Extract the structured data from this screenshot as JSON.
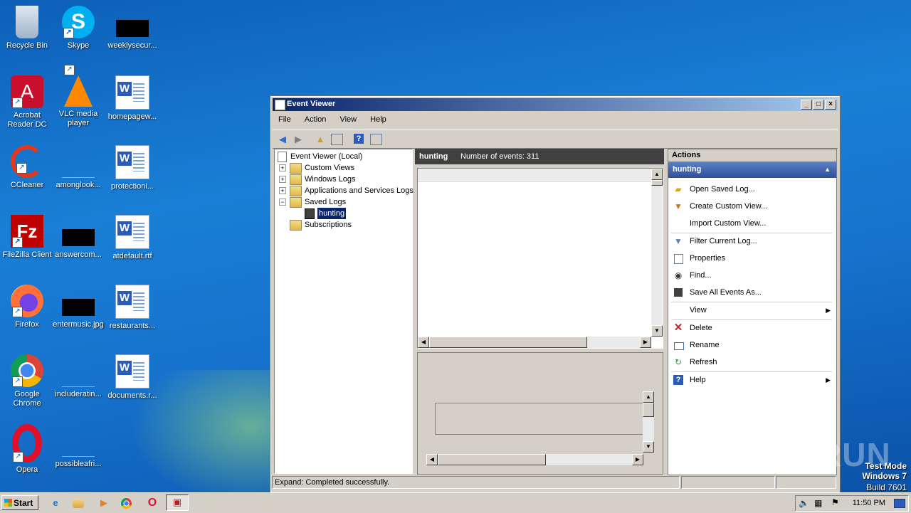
{
  "desktop": {
    "icons": [
      {
        "label": "Recycle Bin"
      },
      {
        "label": "Skype"
      },
      {
        "label": "weeklysecur..."
      },
      {
        "label": "Acrobat Reader DC"
      },
      {
        "label": "VLC media player"
      },
      {
        "label": "homepagew..."
      },
      {
        "label": "CCleaner"
      },
      {
        "label": "amonglook..."
      },
      {
        "label": "protectioni..."
      },
      {
        "label": "FileZilla Client"
      },
      {
        "label": "answercom..."
      },
      {
        "label": "atdefault.rtf"
      },
      {
        "label": "Firefox"
      },
      {
        "label": "entermusic.jpg"
      },
      {
        "label": "restaurants..."
      },
      {
        "label": "Google Chrome"
      },
      {
        "label": "includeratin..."
      },
      {
        "label": "documents.r..."
      },
      {
        "label": "Opera"
      },
      {
        "label": "possibleafri..."
      }
    ],
    "watermark": {
      "brand": "ANY RUN",
      "line1": "Test Mode",
      "line2": "Windows 7",
      "line3": "Build 7601"
    }
  },
  "window": {
    "title": "Event Viewer",
    "menu": [
      "File",
      "Action",
      "View",
      "Help"
    ],
    "tree": [
      {
        "label": "Event Viewer (Local)"
      },
      {
        "label": "Custom Views",
        "expander": "+"
      },
      {
        "label": "Windows Logs",
        "expander": "+"
      },
      {
        "label": "Applications and Services Logs",
        "expander": "+"
      },
      {
        "label": "Saved Logs",
        "expander": "−"
      },
      {
        "label": "hunting"
      },
      {
        "label": "Subscriptions"
      }
    ],
    "center": {
      "log_name": "hunting",
      "count_text": "Number of events: 311"
    },
    "actions": {
      "header": "Actions",
      "section": "hunting",
      "items": [
        {
          "label": "Open Saved Log...",
          "icon": "folder-open-icon"
        },
        {
          "label": "Create Custom View...",
          "icon": "filter-star-icon"
        },
        {
          "label": "Import Custom View...",
          "icon": ""
        },
        {
          "label": "Filter Current Log...",
          "icon": "filter-icon"
        },
        {
          "label": "Properties",
          "icon": "properties-icon"
        },
        {
          "label": "Find...",
          "icon": "binoculars-icon"
        },
        {
          "label": "Save All Events As...",
          "icon": "save-icon"
        },
        {
          "label": "View",
          "icon": ""
        },
        {
          "label": "Delete",
          "icon": "delete-icon"
        },
        {
          "label": "Rename",
          "icon": "rename-icon"
        },
        {
          "label": "Refresh",
          "icon": "refresh-icon"
        },
        {
          "label": "Help",
          "icon": "help-icon"
        }
      ]
    },
    "status": "Expand:  Completed successfully."
  },
  "taskbar": {
    "start": "Start",
    "clock": "11:50 PM"
  }
}
